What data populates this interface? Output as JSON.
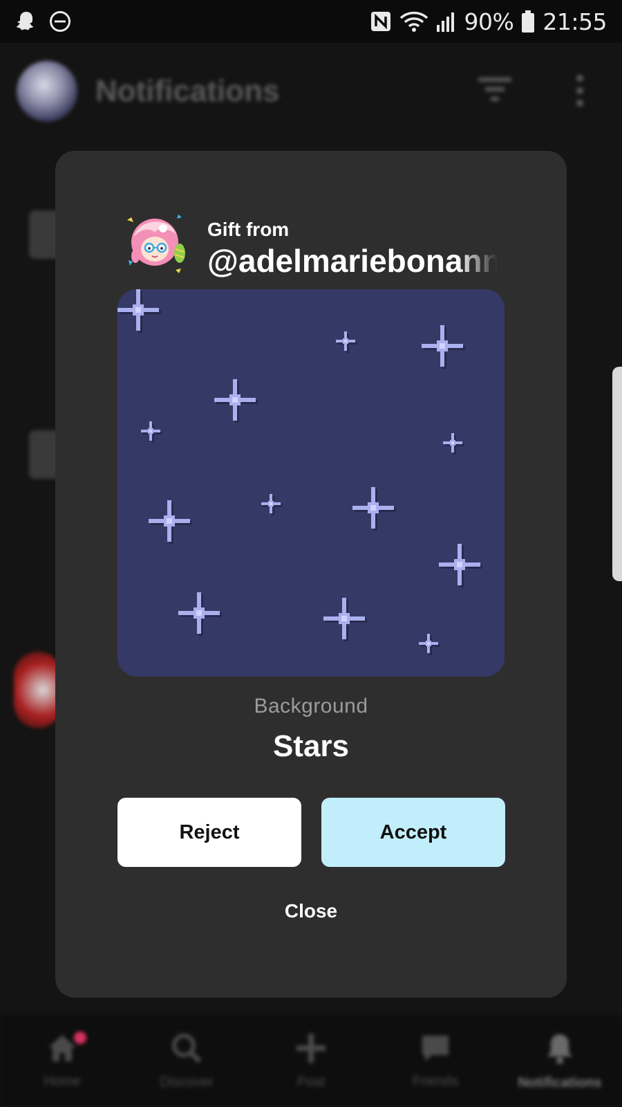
{
  "status_bar": {
    "battery": "90%",
    "time": "21:55",
    "left_icons": [
      "snapchat-icon",
      "do-not-disturb-icon"
    ],
    "right_icons": [
      "nfc-icon",
      "wifi-icon",
      "signal-icon",
      "battery-icon"
    ]
  },
  "header": {
    "title": "Notifications",
    "icons": [
      "avatar",
      "filter-icon",
      "more-vertical-icon"
    ]
  },
  "modal": {
    "gift_from_label": "Gift from",
    "sender_handle": "@adelmariebonanno",
    "item_category": "Background",
    "item_name": "Stars",
    "reject_label": "Reject",
    "accept_label": "Accept",
    "close_label": "Close"
  },
  "bottom_nav": {
    "items": [
      {
        "label": "Home",
        "icon": "home-icon",
        "badge": true
      },
      {
        "label": "Discover",
        "icon": "search-icon"
      },
      {
        "label": "Post",
        "icon": "plus-icon"
      },
      {
        "label": "Friends",
        "icon": "chat-icon"
      },
      {
        "label": "Notifications",
        "icon": "bell-icon",
        "active": true
      }
    ]
  },
  "colors": {
    "modal_bg": "#2e2e2e",
    "preview_bg": "#353966",
    "star": "#aab0ee",
    "accept": "#c2eefb",
    "reject": "#ffffff"
  }
}
